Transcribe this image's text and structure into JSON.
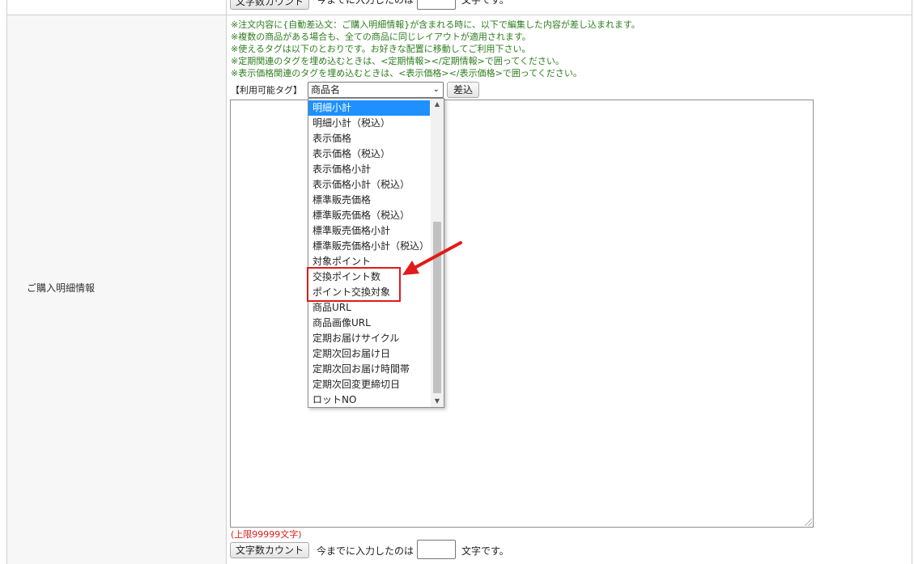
{
  "top_row": {
    "count_button_label": "文字数カウント",
    "prefix_text": "今までに入力したのは",
    "suffix_text": "文字です。"
  },
  "row": {
    "label": "ご購入明細情報",
    "notes": [
      "※注文内容に{自動差込文：ご購入明細情報}が含まれる時に、以下で編集した内容が差し込まれます。",
      "※複数の商品がある場合も、全ての商品に同じレイアウトが適用されます。",
      "※使えるタグは以下のとおりです。お好きな配置に移動してご利用下さい。",
      "※定期関連のタグを埋め込むときは、<定期情報></定期情報>で囲ってください。",
      "※表示価格関連のタグを埋め込むときは、<表示価格></表示価格>で囲ってください。"
    ],
    "tag_label": "【利用可能タグ】",
    "select_value": "商品名",
    "insert_button": "差込",
    "dropdown_options": [
      "明細小計",
      "明細小計（税込）",
      "表示価格",
      "表示価格（税込）",
      "表示価格小計",
      "表示価格小計（税込）",
      "標準販売価格",
      "標準販売価格（税込）",
      "標準販売価格小計",
      "標準販売価格小計（税込）",
      "対象ポイント",
      "交換ポイント数",
      "ポイント交換対象",
      "商品URL",
      "商品画像URL",
      "定期お届けサイクル",
      "定期次回お届け日",
      "定期次回お届け時間帯",
      "定期次回変更締切日",
      "ロットNO"
    ],
    "selected_option_index": 0,
    "limit_text": "(上限99999文字)",
    "count_button_label": "文字数カウント",
    "prefix_text": "今までに入力したのは",
    "suffix_text": "文字です。"
  },
  "colors": {
    "note_green": "#2e7d1e",
    "highlight_red": "#e01b1b",
    "selected_blue": "#1e90ff",
    "limit_red": "#d62020"
  }
}
